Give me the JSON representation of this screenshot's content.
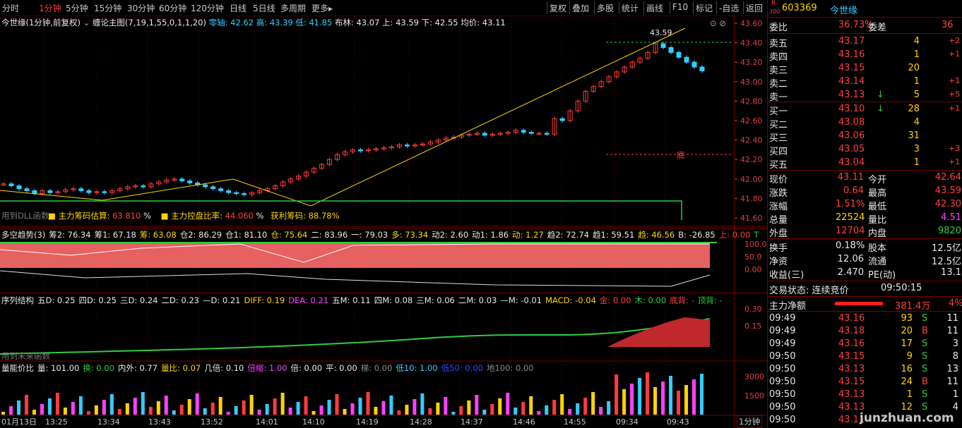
{
  "toolbar": {
    "periods": [
      "分时",
      "1分钟",
      "5分钟",
      "15分钟",
      "30分钟",
      "60分钟",
      "120分钟",
      "日线",
      "5日线",
      "多周期",
      "更多▸"
    ],
    "active_period": "1分钟",
    "right_buttons": [
      "复权",
      "叠加",
      "多股",
      "统计",
      "画线",
      "F10",
      "标记",
      "-自选",
      "返回"
    ]
  },
  "main_info": {
    "title": "今世缘(1分钟,前复权)",
    "indicator": "缠论主图(7,19,1,55,0,1,1,20)",
    "zero_axis": "零轴: 42.62",
    "high": "高: 43.39",
    "low": "低: 41.85",
    "boll": "布林: 43.07",
    "upper": "上: 43.59",
    "lower": "下: 42.55",
    "avg": "均价: 43.11"
  },
  "main_annot": {
    "peak": "43.59",
    "bottom": "底",
    "used_dll": "用到DLL函数",
    "chips_label": "■ 主力筹码估算:",
    "chips_value": "63.810",
    "chips_pct": "%",
    "control_label": "■ 主力控盘比率:",
    "control_value": "44.060",
    "control_pct": "%",
    "profit_label": "获利筹码:",
    "profit_value": "88.78%"
  },
  "price_axis": [
    "43.60",
    "43.40",
    "43.20",
    "43.00",
    "42.80",
    "42.60",
    "42.40",
    "42.20",
    "42.00",
    "41.80",
    "41.60"
  ],
  "panel2": {
    "title": "多空趋势(3)",
    "items": [
      {
        "t": "筹2: 76.34",
        "c": "#e8e8e8"
      },
      {
        "t": "筹1: 67.18",
        "c": "#e8e8e8"
      },
      {
        "t": "筹: 63.08",
        "c": "#ffd400"
      },
      {
        "t": "仓2: 86.29",
        "c": "#e8e8e8"
      },
      {
        "t": "仓1: 81.10",
        "c": "#e8e8e8"
      },
      {
        "t": "仓: 75.64",
        "c": "#ffd400"
      },
      {
        "t": "二: 83.96",
        "c": "#e8e8e8"
      },
      {
        "t": "一: 79.03",
        "c": "#e8e8e8"
      },
      {
        "t": "多: 73.34",
        "c": "#ffd400"
      },
      {
        "t": "动2: 2.60",
        "c": "#e8e8e8"
      },
      {
        "t": "动1: 1.86",
        "c": "#e8e8e8"
      },
      {
        "t": "动: 1.27",
        "c": "#ffd400"
      },
      {
        "t": "趋2: 72.74",
        "c": "#e8e8e8"
      },
      {
        "t": "趋1: 59.51",
        "c": "#e8e8e8"
      },
      {
        "t": "趋: 46.56",
        "c": "#ffd400"
      },
      {
        "t": "B: -26.85",
        "c": "#e8e8e8"
      },
      {
        "t": "上: 0.00",
        "c": "#ff4040"
      },
      {
        "t": "T",
        "c": "#2ecc40"
      }
    ],
    "axis": [
      "100.0",
      "50.0",
      "0.00"
    ]
  },
  "panel3": {
    "title": "序列结构",
    "items": [
      {
        "t": "五D: 0.25",
        "c": "#e8e8e8"
      },
      {
        "t": "四D: 0.25",
        "c": "#e8e8e8"
      },
      {
        "t": "三D: 0.24",
        "c": "#e8e8e8"
      },
      {
        "t": "二D: 0.23",
        "c": "#e8e8e8"
      },
      {
        "t": "—D: 0.21",
        "c": "#e8e8e8"
      },
      {
        "t": "DIFF: 0.19",
        "c": "#ffd400"
      },
      {
        "t": "DEA: 0.21",
        "c": "#ff40ff"
      },
      {
        "t": "五M: 0.11",
        "c": "#e8e8e8"
      },
      {
        "t": "四M: 0.08",
        "c": "#e8e8e8"
      },
      {
        "t": "三M: 0.06",
        "c": "#e8e8e8"
      },
      {
        "t": "二M: 0.03",
        "c": "#e8e8e8"
      },
      {
        "t": "—M: -0.01",
        "c": "#e8e8e8"
      },
      {
        "t": "MACD: -0.04",
        "c": "#ffd400"
      },
      {
        "t": "金: 0.00",
        "c": "#ff4040"
      },
      {
        "t": "木: 0.00",
        "c": "#2ecc40"
      },
      {
        "t": "底背: -",
        "c": "#ff4040"
      },
      {
        "t": "顶背: -",
        "c": "#2ecc40"
      }
    ],
    "used_dll": "用到未来函数",
    "axis": [
      "0.30",
      "0.15"
    ]
  },
  "panel4": {
    "title": "量能价比",
    "items": [
      {
        "t": "量: 101.00",
        "c": "#e8e8e8"
      },
      {
        "t": "换: 0.00",
        "c": "#2ecc40"
      },
      {
        "t": "内外: 0.77",
        "c": "#e8e8e8"
      },
      {
        "t": "量比: 0.07",
        "c": "#ffd400"
      },
      {
        "t": "几倍: 0.10",
        "c": "#e8e8e8"
      },
      {
        "t": "倍缩: 1.00",
        "c": "#ff40ff"
      },
      {
        "t": "倍: 0.00",
        "c": "#e8e8e8"
      },
      {
        "t": "平: 0.00",
        "c": "#e8e8e8"
      },
      {
        "t": "梯: 0.00",
        "c": "#888888"
      },
      {
        "t": "低10: 1.00",
        "c": "#3cf"
      },
      {
        "t": "低50: 0.00",
        "c": "#3344ff"
      },
      {
        "t": "地100: 0.00",
        "c": "#888888"
      }
    ],
    "axis": [
      "3000",
      "1500"
    ]
  },
  "time_axis": [
    "01月13日",
    "13:25",
    "13:34",
    "13:43",
    "13:52",
    "14:01",
    "14:10",
    "14:19",
    "14:28",
    "14:37",
    "14:46",
    "14:55",
    "09:34",
    "09:43"
  ],
  "period_badge": "1分钟",
  "right_panel": {
    "code": "603369",
    "name": "今世缘",
    "badge": "R",
    "badge_num": "300",
    "weibi_label": "委比",
    "weibi_value": "36.73%",
    "weicha_label": "委差",
    "weicha_value": "36",
    "asks": [
      {
        "label": "卖五",
        "price": "43.17",
        "vol": "4",
        "chg": "+2",
        "arrow": ""
      },
      {
        "label": "卖四",
        "price": "43.16",
        "vol": "1",
        "chg": "+1",
        "arrow": ""
      },
      {
        "label": "卖三",
        "price": "43.15",
        "vol": "20",
        "chg": "",
        "arrow": ""
      },
      {
        "label": "卖二",
        "price": "43.14",
        "vol": "1",
        "chg": "+1",
        "arrow": ""
      },
      {
        "label": "卖一",
        "price": "43.13",
        "vol": "5",
        "chg": "+5",
        "arrow": "↓"
      }
    ],
    "bids": [
      {
        "label": "买一",
        "price": "43.10",
        "vol": "28",
        "chg": "+1",
        "arrow": "↓"
      },
      {
        "label": "买二",
        "price": "43.08",
        "vol": "4",
        "chg": "",
        "arrow": ""
      },
      {
        "label": "买三",
        "price": "43.06",
        "vol": "31",
        "chg": "",
        "arrow": ""
      },
      {
        "label": "买四",
        "price": "43.05",
        "vol": "3",
        "chg": "+3",
        "arrow": ""
      },
      {
        "label": "买五",
        "price": "43.04",
        "vol": "1",
        "chg": "+1",
        "arrow": ""
      }
    ],
    "quote": [
      {
        "l1": "现价",
        "v1": "43.11",
        "c1": "#ff4040",
        "l2": "今开",
        "v2": "42.64",
        "c2": "#ff4040"
      },
      {
        "l1": "涨跌",
        "v1": "0.64",
        "c1": "#ff4040",
        "l2": "最高",
        "v2": "43.59",
        "c2": "#ff4040"
      },
      {
        "l1": "涨幅",
        "v1": "1.51%",
        "c1": "#ff4040",
        "l2": "最低",
        "v2": "42.30",
        "c2": "#ff4040"
      },
      {
        "l1": "总量",
        "v1": "22524",
        "c1": "#ffd400",
        "l2": "量比",
        "v2": "4.51",
        "c2": "#ff40ff"
      },
      {
        "l1": "外盘",
        "v1": "12704",
        "c1": "#ff4040",
        "l2": "内盘",
        "v2": "9820",
        "c2": "#2ecc40"
      }
    ],
    "stats": [
      {
        "l1": "换手",
        "v1": "0.18%",
        "l2": "股本",
        "v2": "12.5亿"
      },
      {
        "l1": "净资",
        "v1": "12.06",
        "l2": "流通",
        "v2": "12.5亿"
      },
      {
        "l1": "收益(三)",
        "v1": "2.470",
        "l2": "PE(动)",
        "v2": "13.1"
      }
    ],
    "trade_status": "交易状态: 连续竞价",
    "trade_time": "09:50:15",
    "net_label": "主力净额",
    "net_value": "381.4万",
    "net_pct": "4%",
    "ticks": [
      {
        "time": "09:49",
        "price": "43.16",
        "vol": "93",
        "bs": "S",
        "n": "11"
      },
      {
        "time": "09:49",
        "price": "43.18",
        "vol": "20",
        "bs": "B",
        "n": "11"
      },
      {
        "time": "09:49",
        "price": "43.16",
        "vol": "17",
        "bs": "S",
        "n": "3"
      },
      {
        "time": "09:50",
        "price": "43.15",
        "vol": "9",
        "bs": "S",
        "n": "8"
      },
      {
        "time": "09:50",
        "price": "43.13",
        "vol": "16",
        "bs": "S",
        "n": "13"
      },
      {
        "time": "09:50",
        "price": "43.15",
        "vol": "24",
        "bs": "B",
        "n": "11"
      },
      {
        "time": "09:50",
        "price": "43.13",
        "vol": "1",
        "bs": "S",
        "n": "1"
      },
      {
        "time": "09:50",
        "price": "43.13",
        "vol": "12",
        "bs": "S",
        "n": "4"
      },
      {
        "time": "09:50",
        "price": "43.11",
        "vol": "",
        "bs": "",
        "n": ""
      }
    ],
    "watermark": "junzhuan.com"
  },
  "chart_data": {
    "type": "candlestick",
    "price_range": [
      41.55,
      43.65
    ],
    "high": 43.39,
    "low": 41.85,
    "peak_label": 43.59,
    "closes": [
      41.95,
      41.93,
      41.9,
      41.88,
      41.85,
      41.88,
      41.86,
      41.87,
      41.89,
      41.9,
      41.88,
      41.86,
      41.87,
      41.86,
      41.88,
      41.9,
      41.92,
      41.93,
      41.92,
      41.95,
      41.97,
      41.99,
      42.0,
      41.98,
      41.96,
      41.94,
      41.92,
      41.9,
      41.88,
      41.86,
      41.85,
      41.84,
      41.86,
      41.88,
      41.9,
      41.93,
      41.97,
      42.0,
      42.03,
      42.07,
      42.11,
      42.15,
      42.2,
      42.25,
      42.28,
      42.3,
      42.29,
      42.3,
      42.31,
      42.32,
      42.33,
      42.35,
      42.34,
      42.35,
      42.36,
      42.38,
      42.4,
      42.42,
      42.43,
      42.45,
      42.46,
      42.47,
      42.45,
      42.46,
      42.47,
      42.48,
      42.5,
      42.48,
      42.47,
      42.47,
      42.46,
      42.62,
      42.6,
      42.7,
      42.8,
      42.9,
      42.95,
      43.0,
      43.05,
      43.1,
      43.15,
      43.2,
      43.24,
      43.3,
      43.39,
      43.35,
      43.3,
      43.25,
      43.2,
      43.15,
      43.11
    ],
    "vol_axis": [
      1500,
      3000
    ]
  }
}
